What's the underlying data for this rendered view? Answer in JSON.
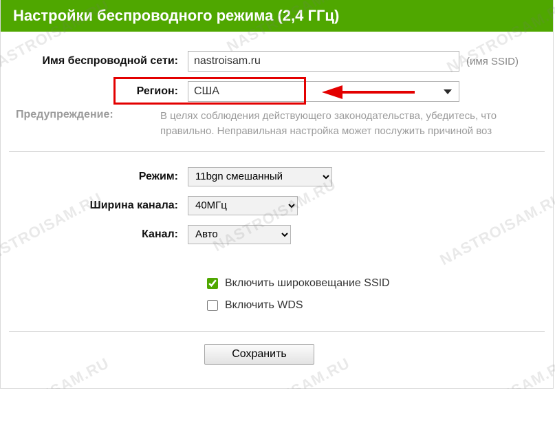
{
  "header": {
    "title": "Настройки беспроводного режима (2,4 ГГц)"
  },
  "form": {
    "ssid": {
      "label": "Имя беспроводной сети:",
      "value": "nastroisam.ru",
      "hint": "(имя SSID)"
    },
    "region": {
      "label": "Регион:",
      "value": "США"
    },
    "warning": {
      "label": "Предупреждение:",
      "text": "В целях соблюдения действующего законодательства, убедитесь, что правильно. Неправильная настройка может послужить причиной воз"
    },
    "mode": {
      "label": "Режим:",
      "value": "11bgn смешанный"
    },
    "channel_width": {
      "label": "Ширина канала:",
      "value": "40МГц"
    },
    "channel": {
      "label": "Канал:",
      "value": "Авто"
    },
    "broadcast_ssid": {
      "label": "Включить широковещание SSID",
      "checked": true
    },
    "wds": {
      "label": "Включить WDS",
      "checked": false
    },
    "save_button": "Сохранить"
  },
  "watermark": "NASTROISAM.RU"
}
